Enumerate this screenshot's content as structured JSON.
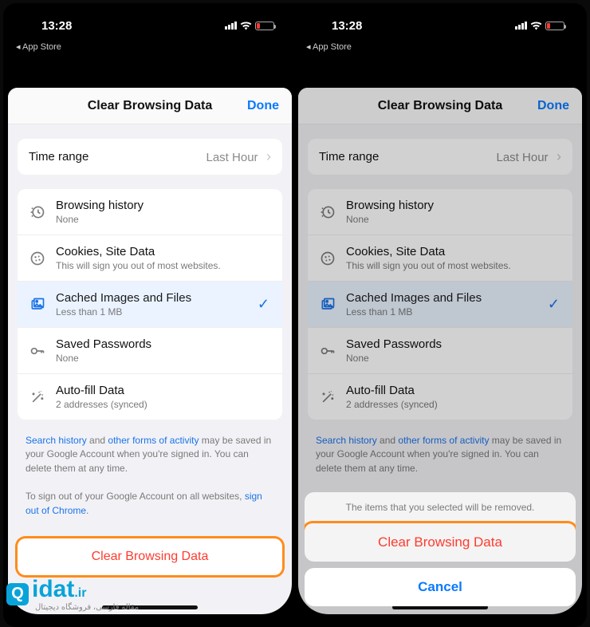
{
  "status": {
    "time": "13:28",
    "back_app": "App Store"
  },
  "header": {
    "title": "Clear Browsing Data",
    "done": "Done"
  },
  "time_range": {
    "label": "Time range",
    "value": "Last Hour"
  },
  "items": [
    {
      "title": "Browsing history",
      "sub": "None"
    },
    {
      "title": "Cookies, Site Data",
      "sub": "This will sign you out of most websites."
    },
    {
      "title": "Cached Images and Files",
      "sub": "Less than 1 MB"
    },
    {
      "title": "Saved Passwords",
      "sub": "None"
    },
    {
      "title": "Auto-fill Data",
      "sub": "2 addresses (synced)"
    }
  ],
  "info1": {
    "link1": "Search history",
    "mid1": " and ",
    "link2": "other forms of activity",
    "tail": " may be saved in your Google Account when you're signed in. You can delete them at any time."
  },
  "info2": {
    "lead": "To sign out of your Google Account on all websites, ",
    "link": "sign out of Chrome",
    "tail": "."
  },
  "clear_button": "Clear Browsing Data",
  "action_sheet": {
    "message": "The items that you selected will be removed.",
    "confirm": "Clear Browsing Data",
    "cancel": "Cancel"
  },
  "watermark": {
    "brand": "idat",
    "sub": "مقاله فارسی، فروشگاه دیجیتال",
    "domain": ".ir"
  }
}
